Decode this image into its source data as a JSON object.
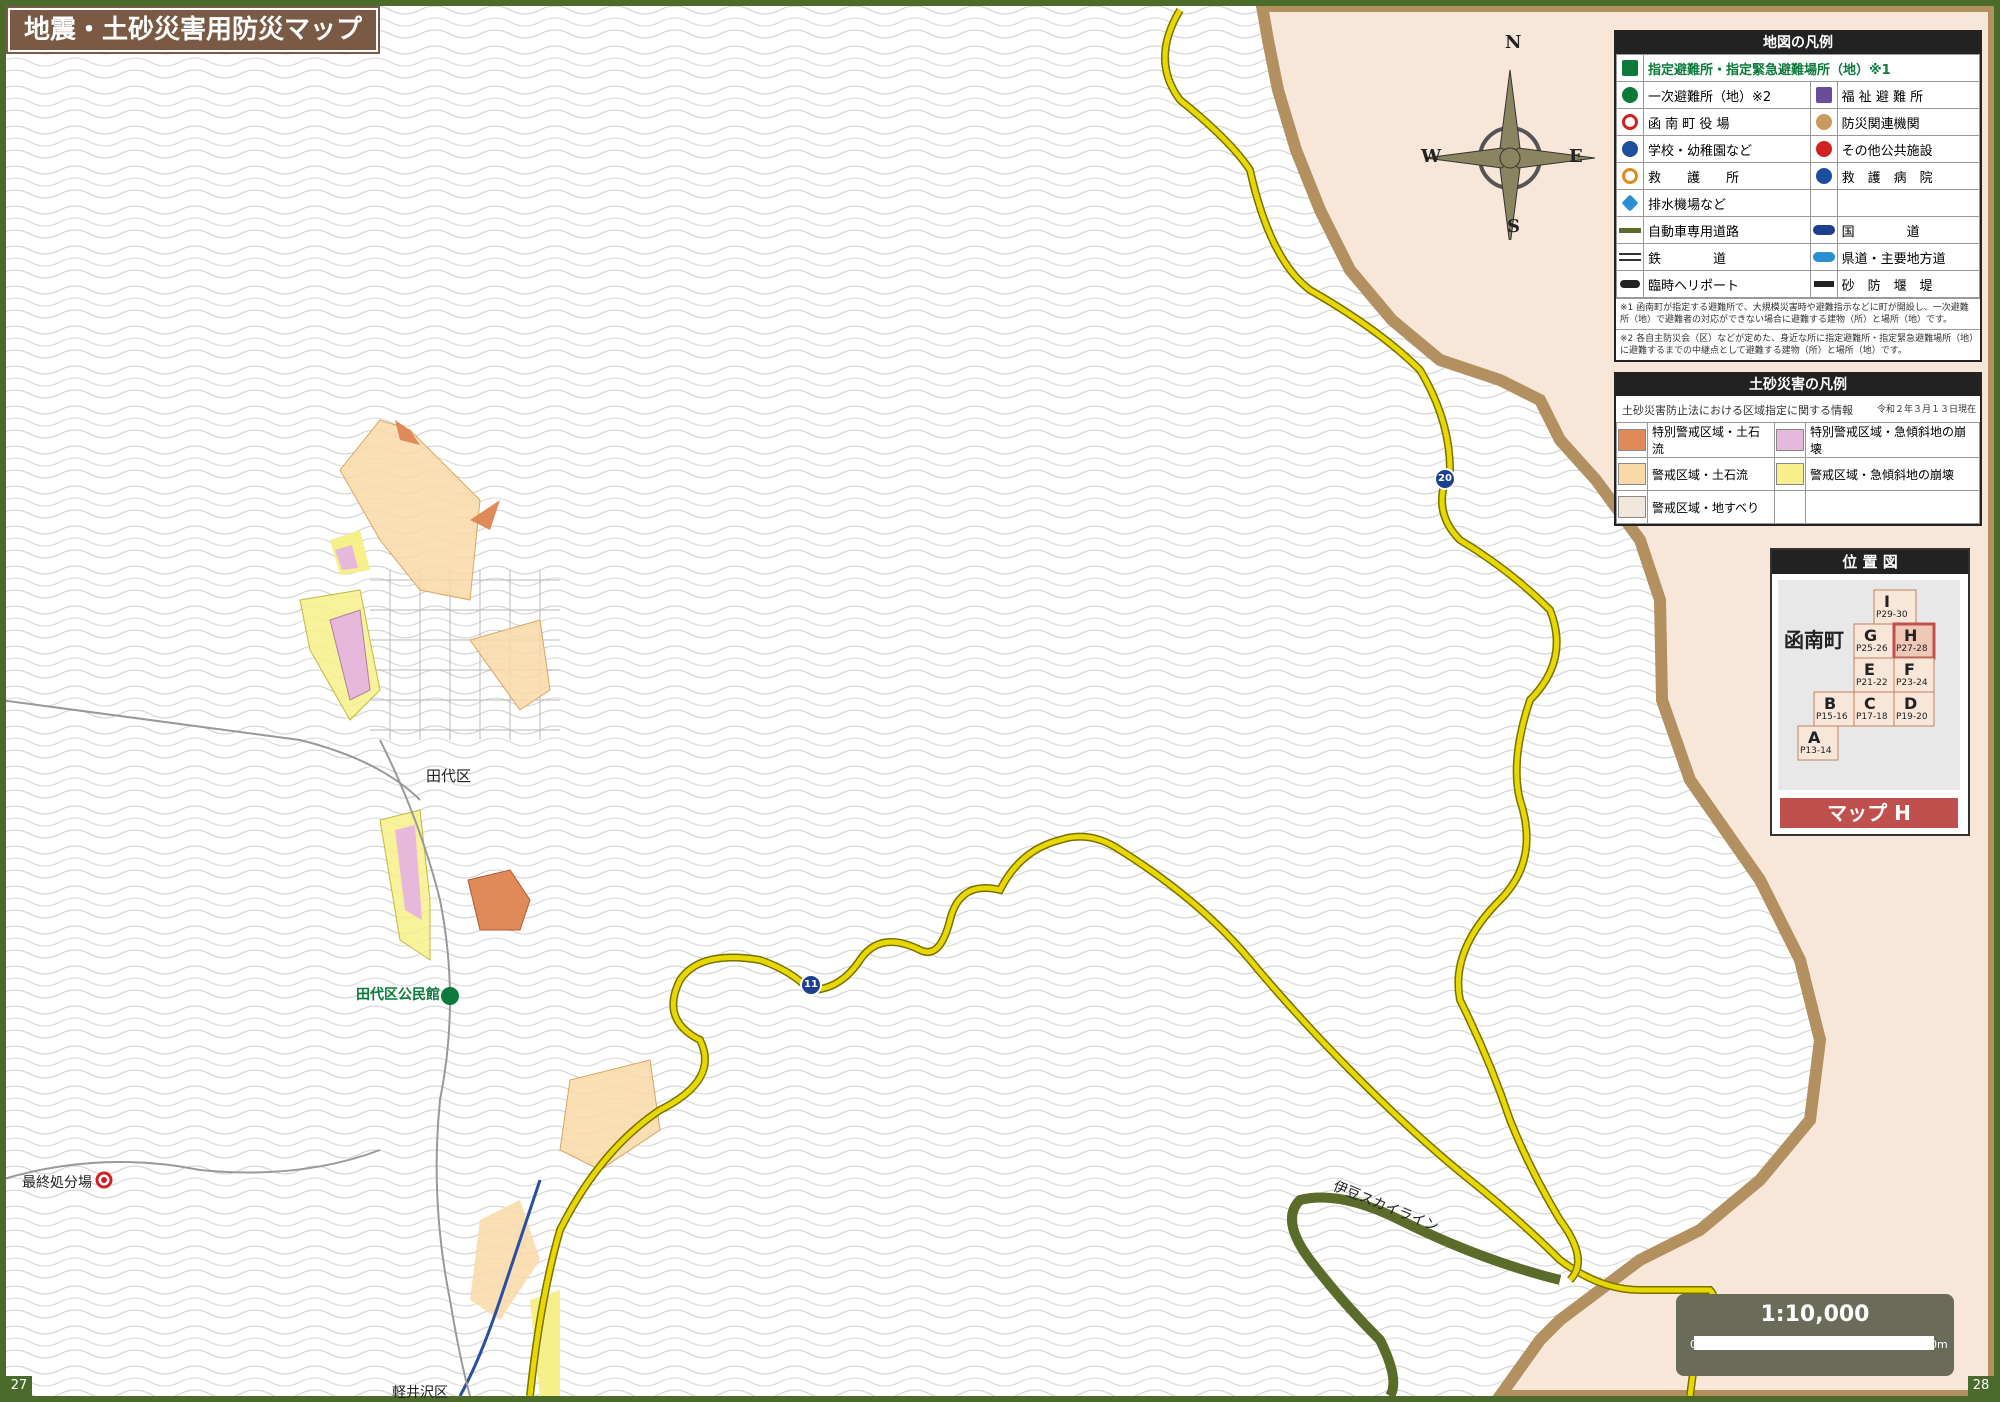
{
  "title": "地震・土砂災害用防災マップ",
  "page_left": "27",
  "page_right": "28",
  "place_labels": {
    "tashiro": "田代区",
    "kominkan": "田代区公民館",
    "saishu": "最終処分場",
    "kawanago": "軽井沢区",
    "izu_skyline": "伊豆スカイライン"
  },
  "route_shields": {
    "r20": "20",
    "r11": "11"
  },
  "compass": {
    "n": "N",
    "s": "S",
    "e": "E",
    "w": "W"
  },
  "legend": {
    "title": "地図の凡例",
    "designated": "指定避難所・指定緊急避難場所（地）※1",
    "rows": [
      {
        "left_icon": "first-evacuation-icon",
        "left": "一次避難所（地）※2",
        "right_icon": "welfare-shelter-icon",
        "right": "福 祉 避 難 所"
      },
      {
        "left_icon": "town-hall-icon",
        "left": "函 南 町 役 場",
        "right_icon": "disaster-agency-icon",
        "right": "防災関連機関"
      },
      {
        "left_icon": "school-icon",
        "left": "学校・幼稚園など",
        "right_icon": "public-facility-icon",
        "right": "その他公共施設"
      },
      {
        "left_icon": "aid-station-icon",
        "left": "救　　護　　所",
        "right_icon": "hospital-icon",
        "right": "救　護　病　院"
      },
      {
        "left_icon": "pump-station-icon",
        "left": "排水機場など",
        "right_icon": "",
        "right": ""
      },
      {
        "left_icon": "expressway-line",
        "left": "自動車専用道路",
        "right_icon": "national-road-shield",
        "right": "国　　　　道"
      },
      {
        "left_icon": "railway-line",
        "left": "鉄　　　　道",
        "right_icon": "prefectural-road-shield",
        "right": "県道・主要地方道"
      },
      {
        "left_icon": "heliport-icon",
        "left": "臨時ヘリポート",
        "right_icon": "sabo-dam-icon",
        "right": "砂　防　堰　堤"
      }
    ],
    "note1": "※1 函南町が指定する避難所で、大規模災害時や避難指示などに町が開設し、一次避難所（地）で避難者の対応ができない場合に避難する建物（所）と場所（地）です。",
    "note2": "※2 各自主防災会（区）などが定めた、身近な所に指定避難所・指定緊急避難場所（地）に避難するまでの中継点として避難する建物（所）と場所（地）です。"
  },
  "sediment_legend": {
    "title": "土砂災害の凡例",
    "date": "令和２年３月１３日現在",
    "subtitle": "土砂災害防止法における区域指定に関する情報",
    "rows": [
      {
        "left_color": "#e08a5a",
        "left": "特別警戒区域・土石流",
        "right_color": "#e6b8dc",
        "right": "特別警戒区域・急傾斜地の崩壊"
      },
      {
        "left_color": "#f9d9a8",
        "left": "警戒区域・土石流",
        "right_color": "#f7f08a",
        "right": "警戒区域・急傾斜地の崩壊"
      },
      {
        "left_color": "#f0e6dc",
        "left": "警戒区域・地すべり",
        "right_color": "",
        "right": ""
      }
    ]
  },
  "location_map": {
    "title": "位 置 図",
    "town": "函南町",
    "cells": [
      {
        "letter": "I",
        "pages": "P29-30"
      },
      {
        "letter": "G",
        "pages": "P25-26"
      },
      {
        "letter": "H",
        "pages": "P27-28"
      },
      {
        "letter": "E",
        "pages": "P21-22"
      },
      {
        "letter": "F",
        "pages": "P23-24"
      },
      {
        "letter": "B",
        "pages": "P15-16"
      },
      {
        "letter": "C",
        "pages": "P17-18"
      },
      {
        "letter": "D",
        "pages": "P19-20"
      },
      {
        "letter": "A",
        "pages": "P13-14"
      }
    ],
    "map_label": "マップ H"
  },
  "scale": {
    "ratio": "1:10,000",
    "zero": "0",
    "max": "500m"
  },
  "colors": {
    "frame_green": "#4a6b2a",
    "title_brown": "#7a5a45",
    "road_yellow": "#e6d800",
    "outside_area": "#f8e6d8",
    "boundary_brown": "#b39060",
    "expressway": "#5a6b2a",
    "river": "#2a4ea0"
  }
}
